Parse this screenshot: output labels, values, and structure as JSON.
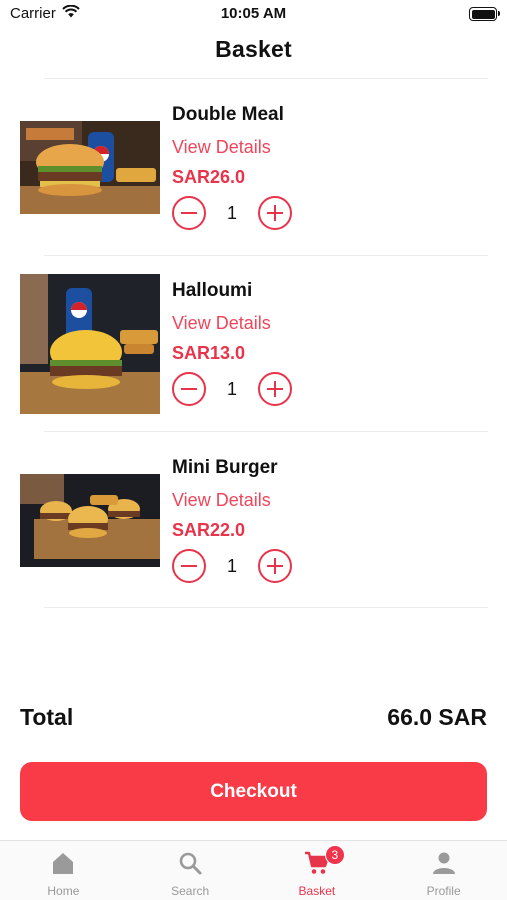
{
  "status_bar": {
    "carrier": "Carrier",
    "time": "10:05 AM"
  },
  "header": {
    "title": "Basket"
  },
  "items": [
    {
      "name": "Double Meal",
      "details_label": "View Details",
      "price": "SAR26.0",
      "quantity": "1"
    },
    {
      "name": "Halloumi",
      "details_label": "View Details",
      "price": "SAR13.0",
      "quantity": "1"
    },
    {
      "name": "Mini Burger",
      "details_label": "View Details",
      "price": "SAR22.0",
      "quantity": "1"
    }
  ],
  "summary": {
    "total_label": "Total",
    "total_value": "66.0 SAR"
  },
  "checkout": {
    "label": "Checkout"
  },
  "tab_bar": {
    "tabs": [
      {
        "label": "Home",
        "icon": "home-icon"
      },
      {
        "label": "Search",
        "icon": "search-icon"
      },
      {
        "label": "Basket",
        "icon": "cart-icon",
        "badge": "3",
        "active": true
      },
      {
        "label": "Profile",
        "icon": "person-icon"
      }
    ]
  },
  "colors": {
    "accent": "#e8344b",
    "checkout": "#f93a47",
    "link": "#f0455a"
  }
}
